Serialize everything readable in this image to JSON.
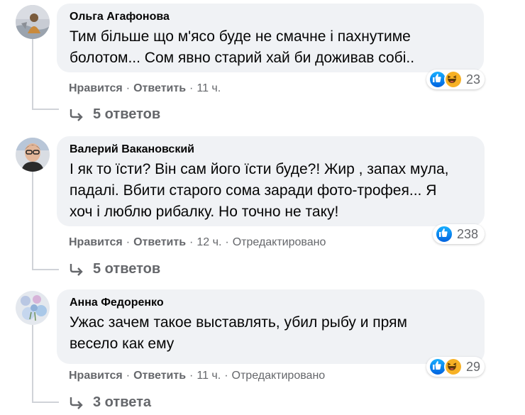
{
  "comments": [
    {
      "author": "Ольга Агафонова",
      "text_lines": [
        "Тим більше що м'ясо буде не смачне і пахнутиме",
        "болотом... Сом явно старий хай би доживав собі.."
      ],
      "reaction_count": "23",
      "reactions": [
        "like-icon",
        "haha-icon"
      ],
      "like_label": "Нравится",
      "reply_label": "Ответить",
      "time": "11 ч.",
      "edited": "",
      "replies_label": "5 ответов"
    },
    {
      "author": "Валерий Вакановский",
      "text_lines": [
        "І як то їсти? Він сам його їсти буде?! Жир , запах мула,",
        "падалі. Вбити старого сома заради фото-трофея... Я",
        "хоч і люблю рибалку. Но точно не таку!"
      ],
      "reaction_count": "238",
      "reactions": [
        "like-icon"
      ],
      "like_label": "Нравится",
      "reply_label": "Ответить",
      "time": "12 ч.",
      "edited": "Отредактировано",
      "replies_label": "5 ответов"
    },
    {
      "author": "Анна Федоренко",
      "text_lines": [
        "Ужас зачем такое выставлять, убил рыбу и прям",
        "весело как ему"
      ],
      "reaction_count": "29",
      "reactions": [
        "like-icon",
        "haha-icon"
      ],
      "like_label": "Нравится",
      "reply_label": "Ответить",
      "time": "11 ч.",
      "edited": "Отредактировано",
      "replies_label": "3 ответа"
    }
  ],
  "colors": {
    "bubble": "#f0f2f5",
    "meta": "#65676b",
    "text": "#050505",
    "like": "#1877f2",
    "haha": "#f7b125"
  }
}
